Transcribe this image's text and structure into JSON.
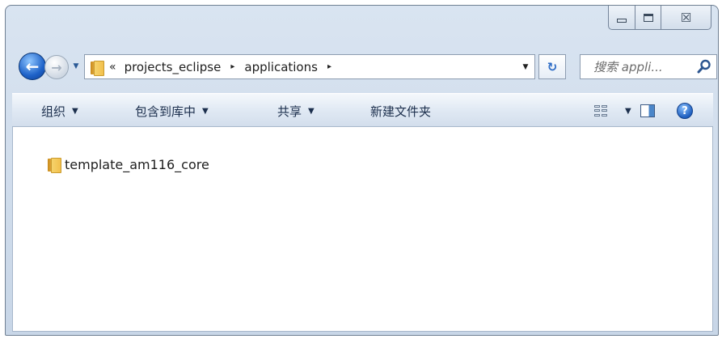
{
  "window": {
    "controls": {
      "minimize_icon": "minimize-icon",
      "maximize_icon": "maximize-icon",
      "close_label": "☒",
      "close_icon": "close-icon"
    }
  },
  "navigation": {
    "back_glyph": "←",
    "forward_glyph": "→",
    "history_glyph": "▼",
    "address": {
      "overflow": "«",
      "crumbs": [
        "projects_eclipse",
        "applications"
      ],
      "separator": "▸",
      "dropdown_glyph": "▼"
    },
    "refresh_glyph": "↻",
    "search": {
      "placeholder": "搜索 appli..."
    }
  },
  "toolbar": {
    "organize_label": "组织",
    "include_library_label": "包含到库中",
    "share_label": "共享",
    "new_folder_label": "新建文件夹",
    "dropdown_glyph": "▼",
    "help_glyph": "?"
  },
  "content": {
    "items": [
      {
        "name": "template_am116_core",
        "type": "folder"
      }
    ]
  },
  "colors": {
    "window_frame": "#d9e4f1",
    "toolbar_bg": "#dfe8f3",
    "accent_blue": "#1f5fbf",
    "folder_yellow": "#f2c04d"
  }
}
